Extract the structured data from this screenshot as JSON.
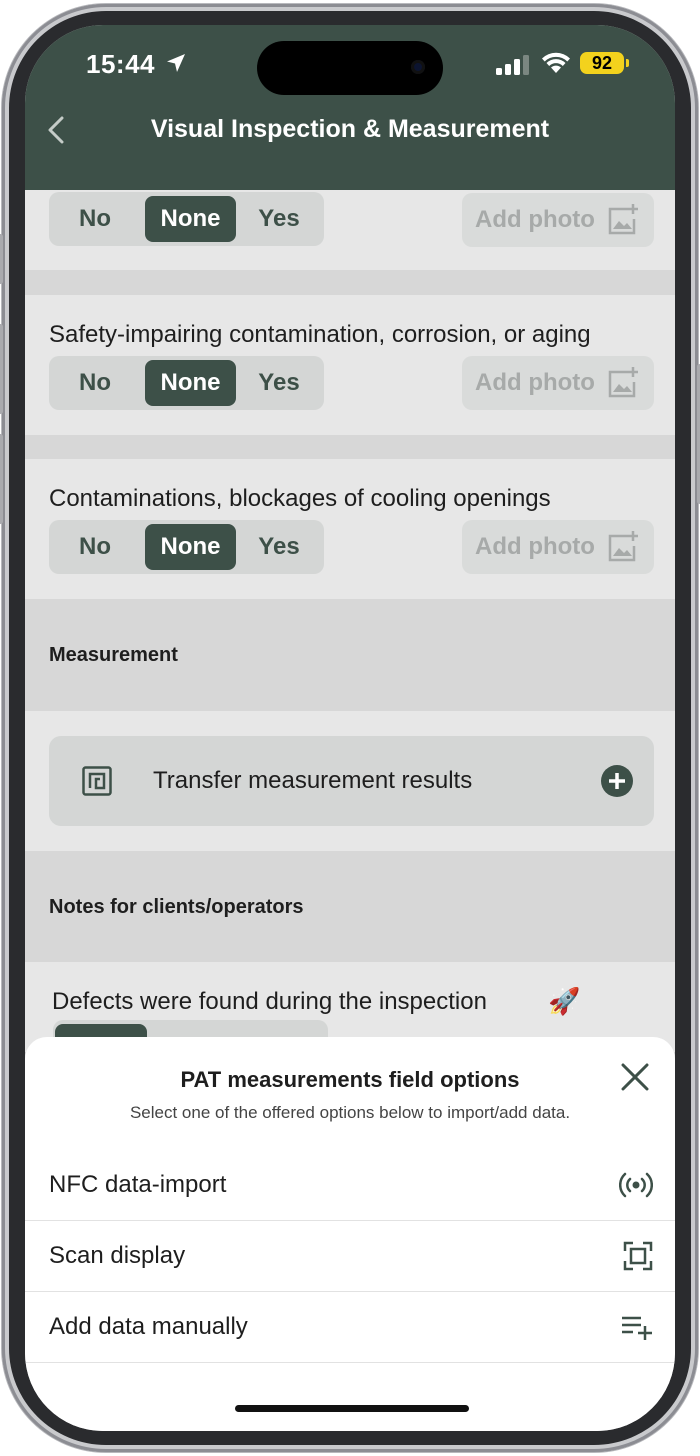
{
  "status_bar": {
    "time": "15:44",
    "battery": "92"
  },
  "header": {
    "title": "Visual Inspection & Measurement"
  },
  "segmented": {
    "no": "No",
    "none": "None",
    "yes": "Yes"
  },
  "add_photo": "Add photo",
  "questions": [
    {
      "label": ""
    },
    {
      "label": "Safety-impairing contamination, corrosion, or aging"
    },
    {
      "label": "Contaminations, blockages of cooling openings"
    }
  ],
  "measurement": {
    "section_title": "Measurement",
    "transfer_label": "Transfer measurement results"
  },
  "notes": {
    "section_title": "Notes for clients/operators",
    "defects_label": "Defects were found during the inspection",
    "emoji": "🚀"
  },
  "sheet": {
    "title": "PAT measurements field options",
    "subtitle": "Select one of the offered options below to import/add data.",
    "options": [
      {
        "label": "NFC data-import",
        "icon": "nfc-icon"
      },
      {
        "label": "Scan display",
        "icon": "scan-icon"
      },
      {
        "label": "Add data manually",
        "icon": "playlist-add-icon"
      }
    ]
  },
  "colors": {
    "primary": "#3d5048",
    "battery": "#f3d21d"
  }
}
